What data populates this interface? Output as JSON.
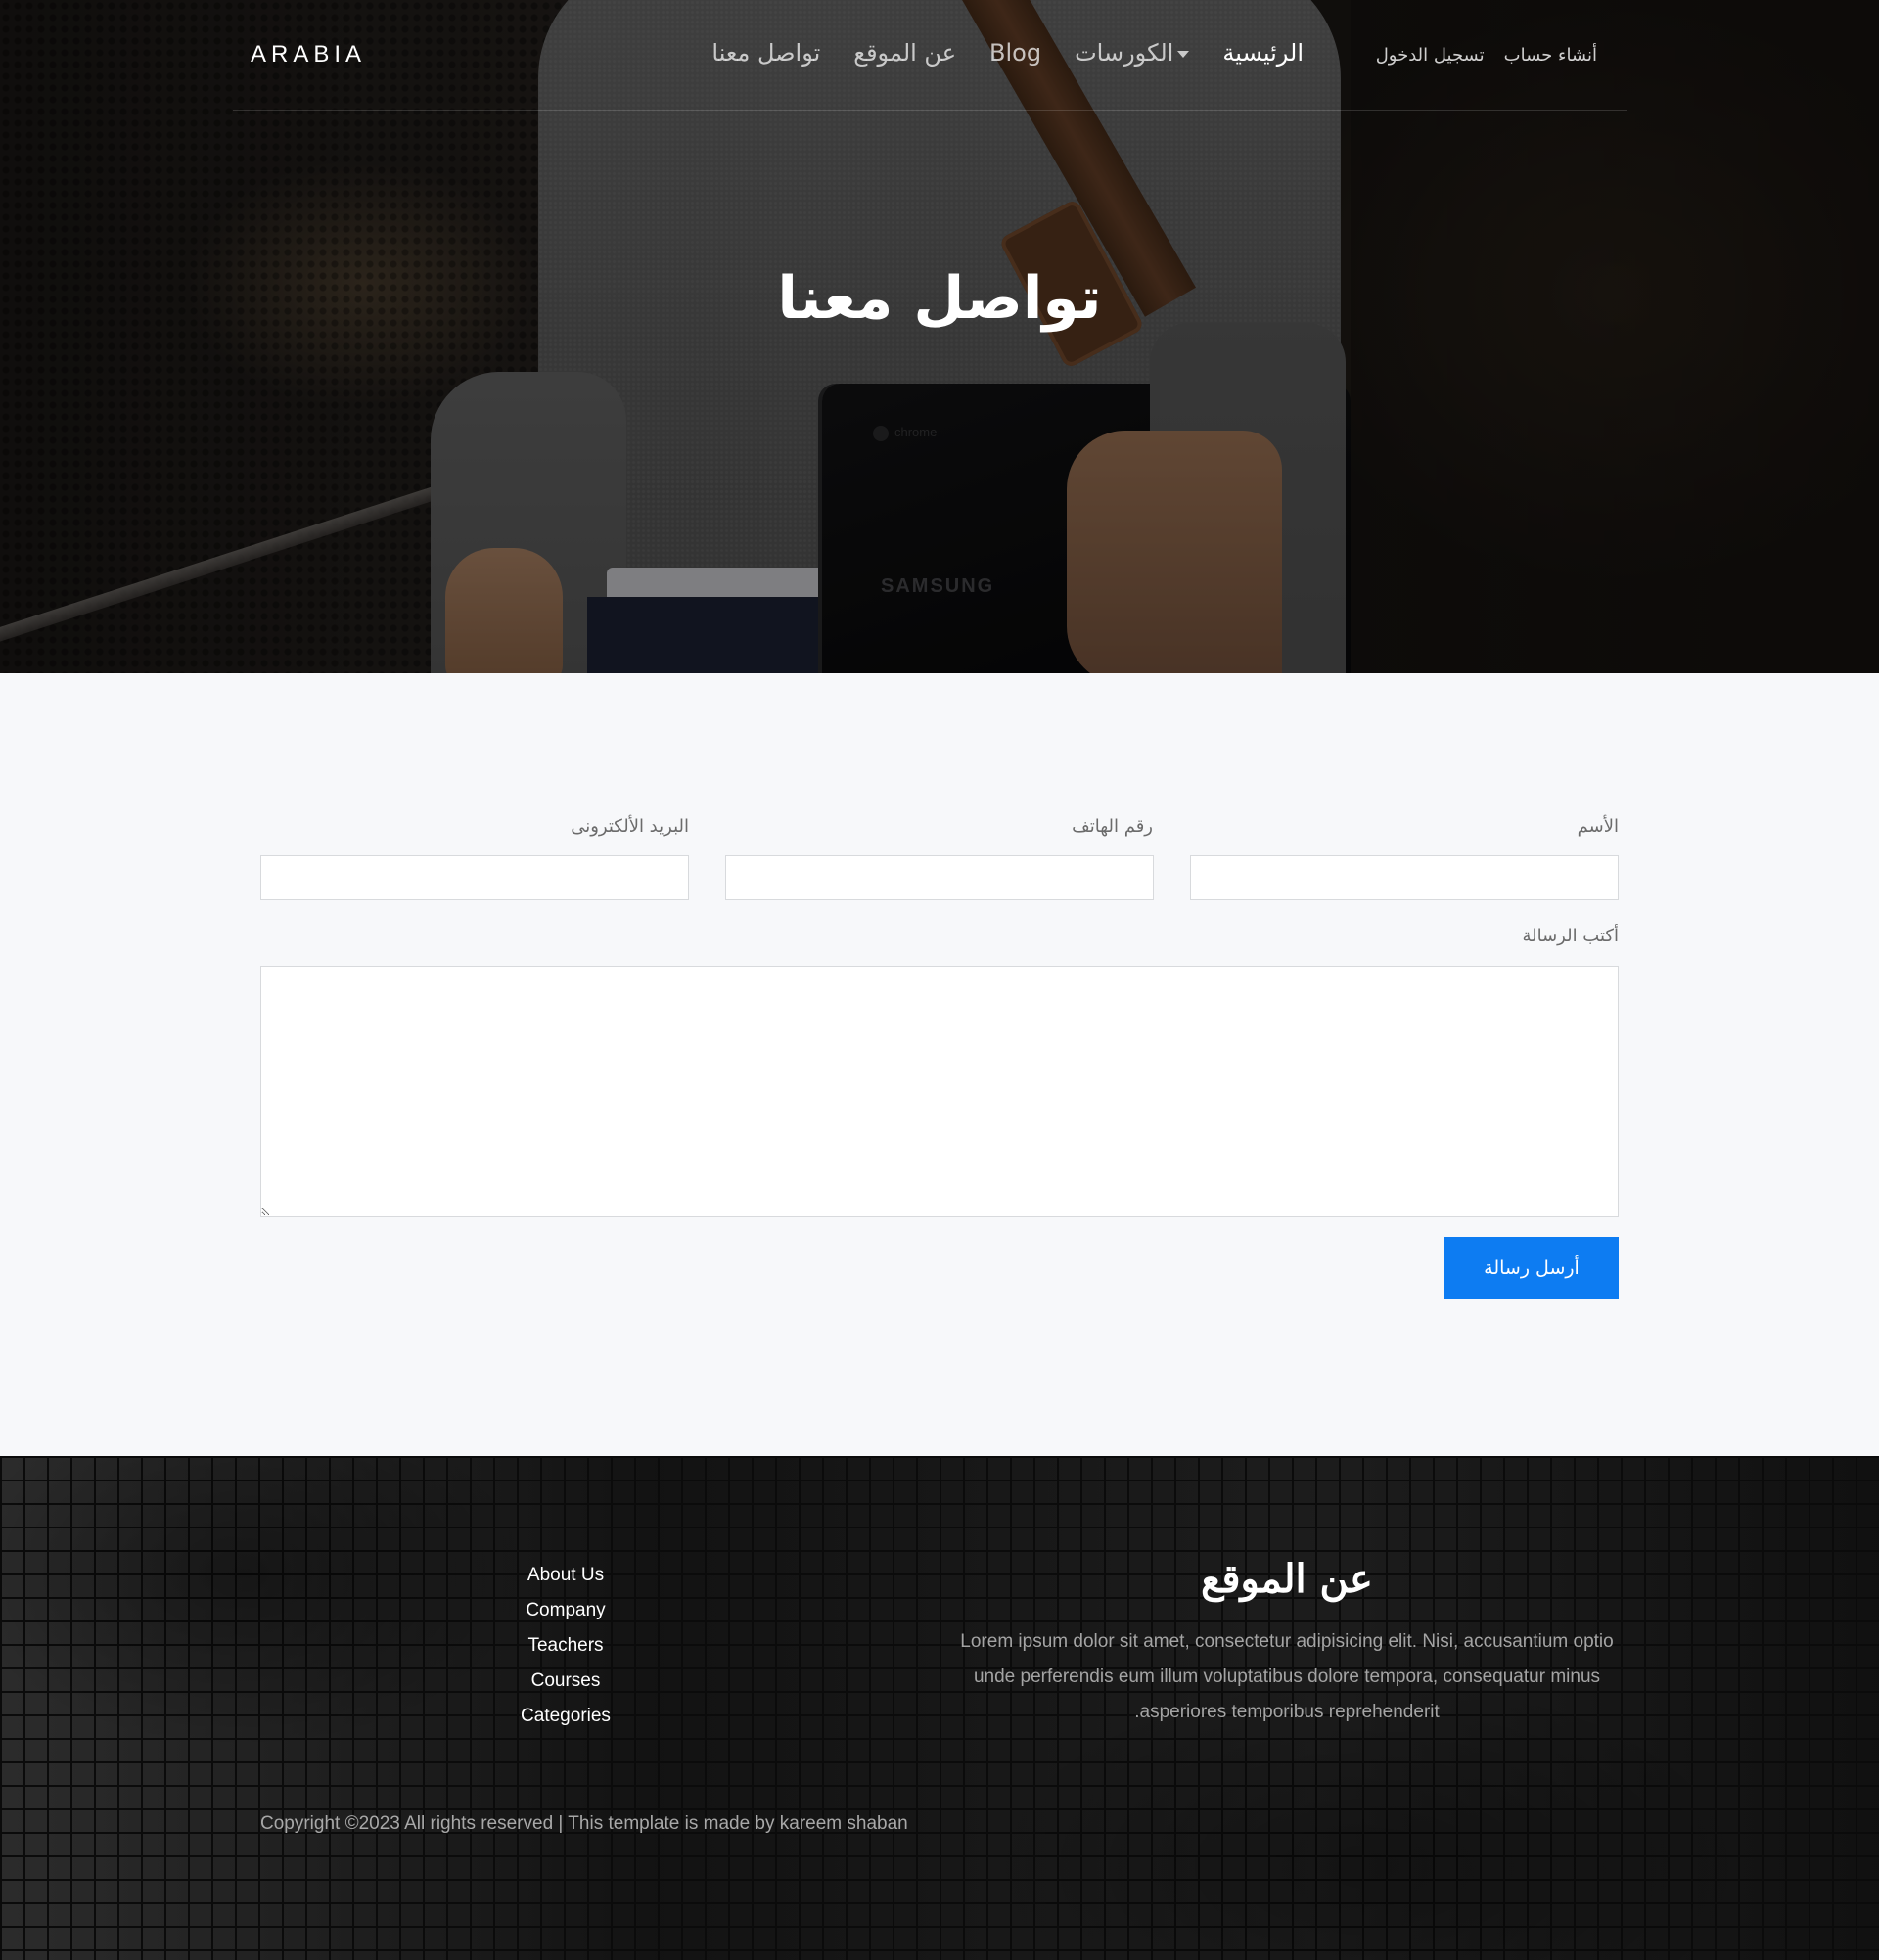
{
  "nav": {
    "logo": "ARABIA",
    "links": [
      {
        "label": "الرئيسية"
      },
      {
        "label": "الكورسات"
      },
      {
        "label": "Blog"
      },
      {
        "label": "عن الموقع"
      },
      {
        "label": "تواصل معنا"
      }
    ],
    "auth": {
      "signup": "أنشاء حساب",
      "login": "تسجيل الدخول"
    }
  },
  "hero": {
    "title": "تواصل معنا",
    "laptop_brand_chrome": "chrome",
    "laptop_brand_samsung": "SAMSUNG"
  },
  "form": {
    "name_label": "الأسم",
    "phone_label": "رقم الهاتف",
    "email_label": "البريد الألكترونى",
    "message_label": "أكتب الرسالة",
    "name_value": "",
    "phone_value": "",
    "email_value": "",
    "message_value": "",
    "submit_label": "أرسل رسالة"
  },
  "footer": {
    "links": [
      "About Us",
      "Company",
      "Teachers",
      "Courses",
      "Categories"
    ],
    "about_title": "عن الموقع",
    "about_text": "Lorem ipsum dolor sit amet, consectetur adipisicing elit. Nisi, accusantium optio unde perferendis eum illum voluptatibus dolore tempora, consequatur minus asperiores temporibus reprehenderit.",
    "copyright": "Copyright ©2023 All rights reserved | This template is made by kareem shaban"
  },
  "colors": {
    "accent": "#0d7cf2",
    "footer_bg": "#0b0b0b",
    "form_bg": "#f7f8fa"
  }
}
